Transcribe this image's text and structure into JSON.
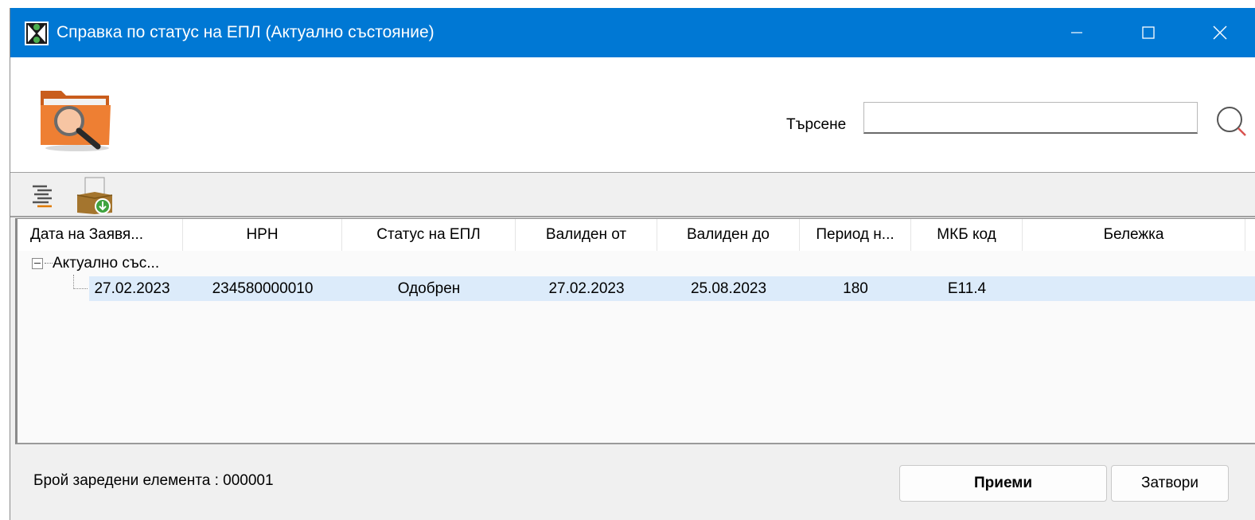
{
  "window": {
    "title": "Справка по статус на ЕПЛ (Актуално състояние)"
  },
  "search": {
    "label": "Търсене",
    "value": "",
    "placeholder": ""
  },
  "table": {
    "columns": [
      "Дата на Заявя...",
      "НРН",
      "Статус на ЕПЛ",
      "Валиден от",
      "Валиден до",
      "Период н...",
      "МКБ код",
      "Бележка"
    ],
    "group_label": "Актуално със...",
    "rows": [
      [
        "27.02.2023",
        "234580000010",
        "Одобрен",
        "27.02.2023",
        "25.08.2023",
        "180",
        "E11.4",
        ""
      ]
    ]
  },
  "footer": {
    "count_text": "Брой заредени елемента : 000001",
    "accept_label": "Приеми",
    "close_label": "Затвори"
  },
  "colors": {
    "titlebar": "#0078d4",
    "selected_row": "#dcebfa"
  }
}
